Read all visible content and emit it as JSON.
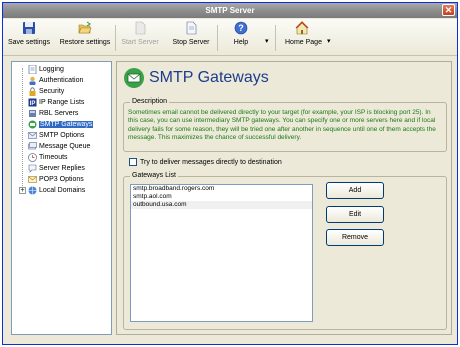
{
  "window": {
    "title": "SMTP Server",
    "close_symbol": "✕"
  },
  "toolbar": {
    "save_label": "Save settings",
    "restore_label": "Restore settings",
    "start_label": "Start Server",
    "stop_label": "Stop Server",
    "help_label": "Help",
    "home_label": "Home Page",
    "dropdown_arrow": "▾"
  },
  "sidebar": {
    "items": [
      {
        "label": "Logging",
        "icon": "log-icon"
      },
      {
        "label": "Authentication",
        "icon": "auth-icon"
      },
      {
        "label": "Security",
        "icon": "security-icon"
      },
      {
        "label": "IP Range Lists",
        "icon": "ip-icon"
      },
      {
        "label": "RBL Servers",
        "icon": "rbl-icon"
      },
      {
        "label": "SMTP Gateways",
        "icon": "gateway-icon",
        "selected": true
      },
      {
        "label": "SMTP Options",
        "icon": "options-icon"
      },
      {
        "label": "Message Queue",
        "icon": "queue-icon"
      },
      {
        "label": "Timeouts",
        "icon": "timeout-icon"
      },
      {
        "label": "Server Replies",
        "icon": "replies-icon"
      },
      {
        "label": "POP3 Options",
        "icon": "pop3-icon"
      },
      {
        "label": "Local Domains",
        "icon": "domains-icon",
        "expandable": true
      }
    ],
    "expander_symbol": "+"
  },
  "main": {
    "title": "SMTP Gateways",
    "description": {
      "legend": "Description",
      "text": "Sometimes email cannot be delivered directly to your target (for example, your ISP is blocking port 25). In this case, you can use intermediary SMTP gateways. You can specify one or more servers here and if local delivery fails for some reason, they will be tried one after another in sequence until one of them accepts the message. This maximizes the chance of successful delivery."
    },
    "direct_delivery_label": "Try to deliver messages directly to destination",
    "gateways": {
      "legend": "Gateways List",
      "items": [
        "smtp.broadband.rogers.com",
        "smtp.aol.com",
        "outbound.usa.com"
      ],
      "selected_index": 2,
      "add_label": "Add",
      "edit_label": "Edit",
      "remove_label": "Remove"
    }
  }
}
